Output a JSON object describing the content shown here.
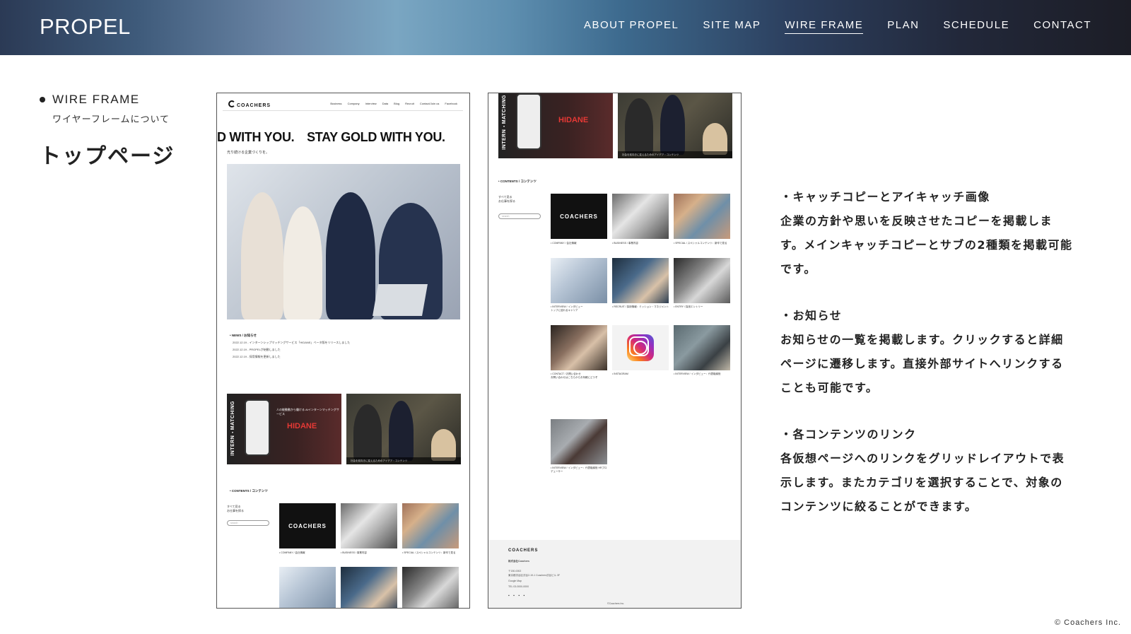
{
  "header": {
    "logo": "PROPEL",
    "nav": [
      "ABOUT PROPEL",
      "SITE MAP",
      "WIRE FRAME",
      "PLAN",
      "SCHEDULE",
      "CONTACT"
    ],
    "active_nav": "WIRE FRAME"
  },
  "section": {
    "title": "WIRE FRAME",
    "subtitle": "ワイヤーフレームについて",
    "page_title": "トップページ"
  },
  "frame1": {
    "logo": "COACHERS",
    "menu": [
      "Business",
      "Company",
      "Interview",
      "Data",
      "Blog",
      "Recruit",
      "Contact/Join us",
      "Facebook"
    ],
    "hero_copy": "D WITH YOU.　STAY GOLD WITH YOU.",
    "hero_sub": "光り続ける企業づくりを。",
    "news_title": "• NEWS / お知らせ",
    "news": [
      "2022.12.19 - インターンシップマッチングサービス「HIDANE」ベータ版をリリースしました",
      "2022.12.19 - PROPELが始動しました",
      "2022.12.19 - 採用情報を更新しました"
    ],
    "banner_a_label": "INTERN・MATCHING",
    "banner_a_sub": "人の能動動から働ける AIインターンマッチングサービス",
    "banner_a_brand": "HIDANE",
    "banner_b_caption": "社会を前向きに変えるためのアイデア・コンテンツ",
    "contents_title": "• CONTENTS / コンテンツ",
    "side_links": [
      "すべて見る",
      "お仕事を探る"
    ],
    "search_placeholder": "search",
    "tiles": [
      "• COMPANY / 会社情報",
      "• BUSINESS / 事業内容",
      "• SPECIAL / スペシャルコンテンツ：新卒で見る"
    ]
  },
  "frame2": {
    "banner_label": "INTERN・MATCHING",
    "banner_brand": "HIDANE",
    "banner_caption": "社会を前向きに変えるためのアイデア・コンテンツ",
    "contents_title": "• CONTENTS / コンテンツ",
    "side_links": [
      "すべて見る",
      "お仕事を探る"
    ],
    "search_placeholder": "search",
    "tiles": [
      {
        "label": "• COMPANY / 会社情報",
        "brand": "COACHERS"
      },
      {
        "label": "• BUSINESS / 事業内容"
      },
      {
        "label": "• SPECIAL / スペシャルコンテンツ：新卒で見る"
      },
      {
        "label": "• INTERVIEW / インタビュー",
        "sub": "トップに迫れるキャリア"
      },
      {
        "label": "• RECRUIT / 採用情報：ミッション・マネジメント"
      },
      {
        "label": "• ENTRY / 採用エントリー"
      },
      {
        "label": "• CONTACT / お問い合わせ",
        "sub": "お問い合わせはこちらからお気軽にどうぞ"
      },
      {
        "label": "• INSTAGRAM"
      },
      {
        "label": "• INTERVIEW / インタビュー：代表取締役"
      },
      {
        "label": "• INTERVIEW / インタビュー：代表取締役 HRプロデューサー"
      }
    ],
    "footer_logo": "COACHERS",
    "footer_company": "株式会社Coachers",
    "footer_lines": [
      "〒150-0002",
      "東京都渋谷区渋谷2-19-1 Coachers渋谷ビル 3F",
      "Google Map",
      "TEL 03-0000-0000"
    ],
    "footer_copy": "©Coachers Inc."
  },
  "description": [
    {
      "head": "・キャッチコピーとアイキャッチ画像",
      "body": "企業の方針や思いを反映させたコピーを掲載しま\nす。メインキャッチコピーとサブの2種類を掲載可能\nです。"
    },
    {
      "head": "・お知らせ",
      "body": "お知らせの一覧を掲載します。クリックすると詳細\nページに遷移します。直接外部サイトへリンクする\nことも可能です。"
    },
    {
      "head": "・各コンテンツのリンク",
      "body": "各仮想ページへのリンクをグリッドレイアウトで表\n示します。またカテゴリを選択することで、対象の\nコンテンツに絞ることができます。"
    }
  ],
  "copyright": "© Coachers Inc."
}
